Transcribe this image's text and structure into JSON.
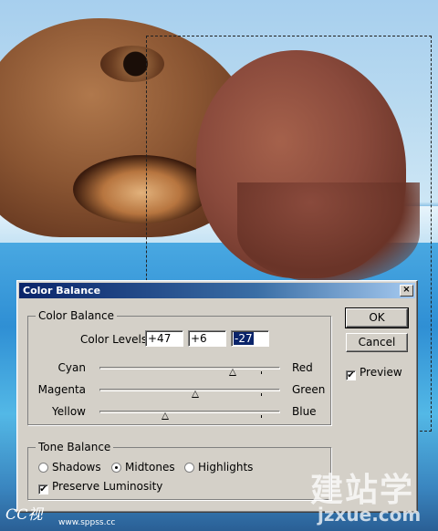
{
  "dialog": {
    "title": "Color Balance",
    "close_glyph": "×",
    "color_balance_group": {
      "title": "Color Balance",
      "levels_label": "Color Levels:",
      "levels": [
        "+47",
        "+6",
        "-27"
      ],
      "sliders": [
        {
          "left": "Cyan",
          "right": "Red",
          "value": 47
        },
        {
          "left": "Magenta",
          "right": "Green",
          "value": 6
        },
        {
          "left": "Yellow",
          "right": "Blue",
          "value": -27
        }
      ]
    },
    "tone_balance_group": {
      "title": "Tone Balance",
      "options": [
        "Shadows",
        "Midtones",
        "Highlights"
      ],
      "selected": "Midtones",
      "preserve_luminosity_label": "Preserve Luminosity",
      "preserve_luminosity_checked": true
    },
    "ok_label": "OK",
    "cancel_label": "Cancel",
    "preview_label": "Preview",
    "preview_checked": true,
    "check_glyph": "✔"
  },
  "watermark": {
    "right_text": "建站学",
    "right_url": "jzxue.com",
    "left_text": "CC视",
    "left_url": "www.sppss.cc"
  }
}
